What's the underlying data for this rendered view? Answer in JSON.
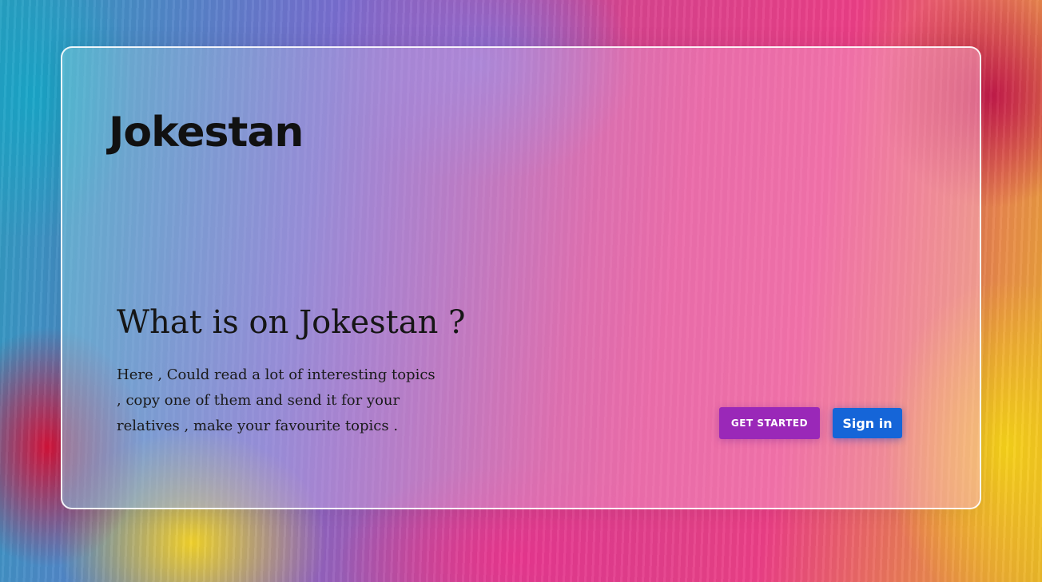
{
  "brand": {
    "name": "Jokestan"
  },
  "hero": {
    "title": "What is on Jokestan ?",
    "description": "Here , Could read a lot of interesting topics , copy one of them and send it for your relatives , make your favourite topics ."
  },
  "actions": {
    "get_started_label": "GET STARTED",
    "sign_in_label": "Sign in"
  },
  "colors": {
    "get_started_bg": "#9a28b8",
    "sign_in_bg": "#1565d8",
    "text": "#111111",
    "card_border": "#ffffff"
  }
}
